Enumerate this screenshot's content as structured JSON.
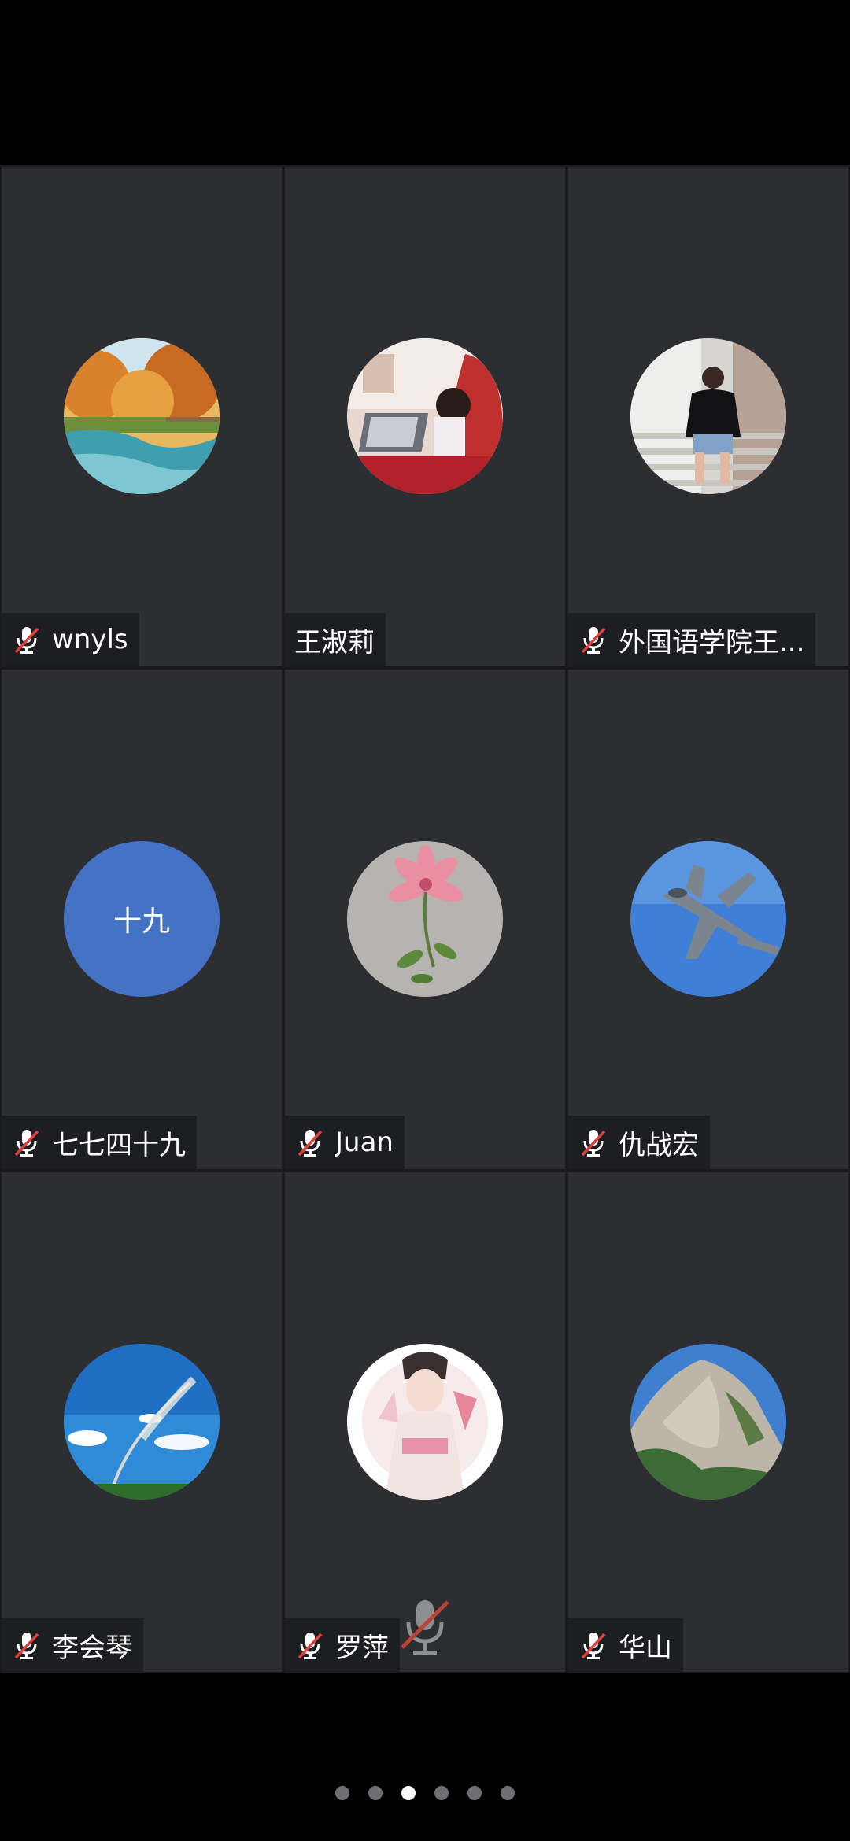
{
  "participants": [
    {
      "name": "wnyls",
      "muted": true,
      "avatar": "autumn-stream-photo"
    },
    {
      "name": "王淑莉",
      "muted": false,
      "avatar": "woman-laptop-photo"
    },
    {
      "name": "外国语学院王...",
      "muted": true,
      "avatar": "woman-on-steps-photo"
    },
    {
      "name": "七七四十九",
      "muted": true,
      "avatar_initials": "十九",
      "avatar_color": "#4472c4"
    },
    {
      "name": "Juan",
      "muted": true,
      "avatar": "pink-flower-photo"
    },
    {
      "name": "仇战宏",
      "muted": true,
      "avatar": "fighter-jet-photo"
    },
    {
      "name": "李会琴",
      "muted": true,
      "avatar": "reed-blue-sky-photo"
    },
    {
      "name": "罗萍",
      "muted": true,
      "avatar": "costume-girl-painting",
      "center_mic_muted": true
    },
    {
      "name": "华山",
      "muted": true,
      "avatar": "mountain-cliff-photo"
    }
  ],
  "pagination": {
    "total_pages": 6,
    "current_page": 3
  },
  "colors": {
    "tile_background": "#2d2e32",
    "mute_slash": "#e0403a",
    "active_dot": "#ffffff",
    "inactive_dot": "#6e6f73"
  }
}
